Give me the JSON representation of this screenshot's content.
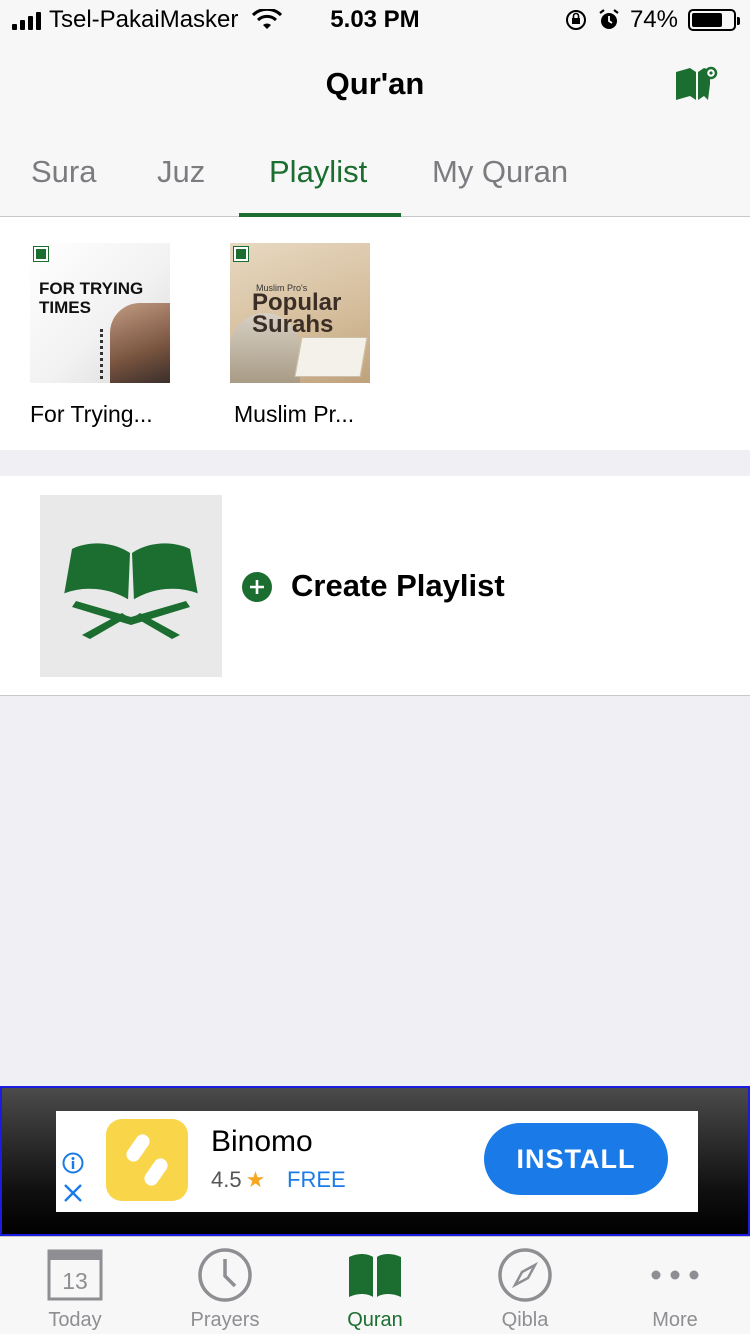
{
  "status_bar": {
    "carrier": "Tsel-PakaiMasker",
    "time": "5.03 PM",
    "battery": "74%",
    "battery_level": 0.74
  },
  "header": {
    "title": "Qur'an",
    "settings_icon": "book-settings-icon"
  },
  "tabs": [
    {
      "label": "Sura"
    },
    {
      "label": "Juz"
    },
    {
      "label": "Playlist",
      "active": true
    },
    {
      "label": "My Quran"
    }
  ],
  "playlists": [
    {
      "caption": "For Trying...",
      "thumb_text": "FOR TRYING TIMES"
    },
    {
      "caption": "Muslim Pr...",
      "thumb_small": "Muslim Pro's",
      "thumb_text": "Popular Surahs"
    }
  ],
  "create": {
    "label": "Create Playlist",
    "icon": "quran-stand-icon"
  },
  "ad": {
    "app_name": "Binomo",
    "rating": "4.5",
    "price": "FREE",
    "cta": "INSTALL"
  },
  "tab_bar": [
    {
      "label": "Today",
      "icon": "calendar-icon",
      "day": "13"
    },
    {
      "label": "Prayers",
      "icon": "clock-icon"
    },
    {
      "label": "Quran",
      "icon": "book-icon",
      "active": true
    },
    {
      "label": "Qibla",
      "icon": "compass-icon"
    },
    {
      "label": "More",
      "icon": "more-icon"
    }
  ],
  "colors": {
    "accent": "#1b6e30",
    "ad_button": "#1a7be8"
  }
}
